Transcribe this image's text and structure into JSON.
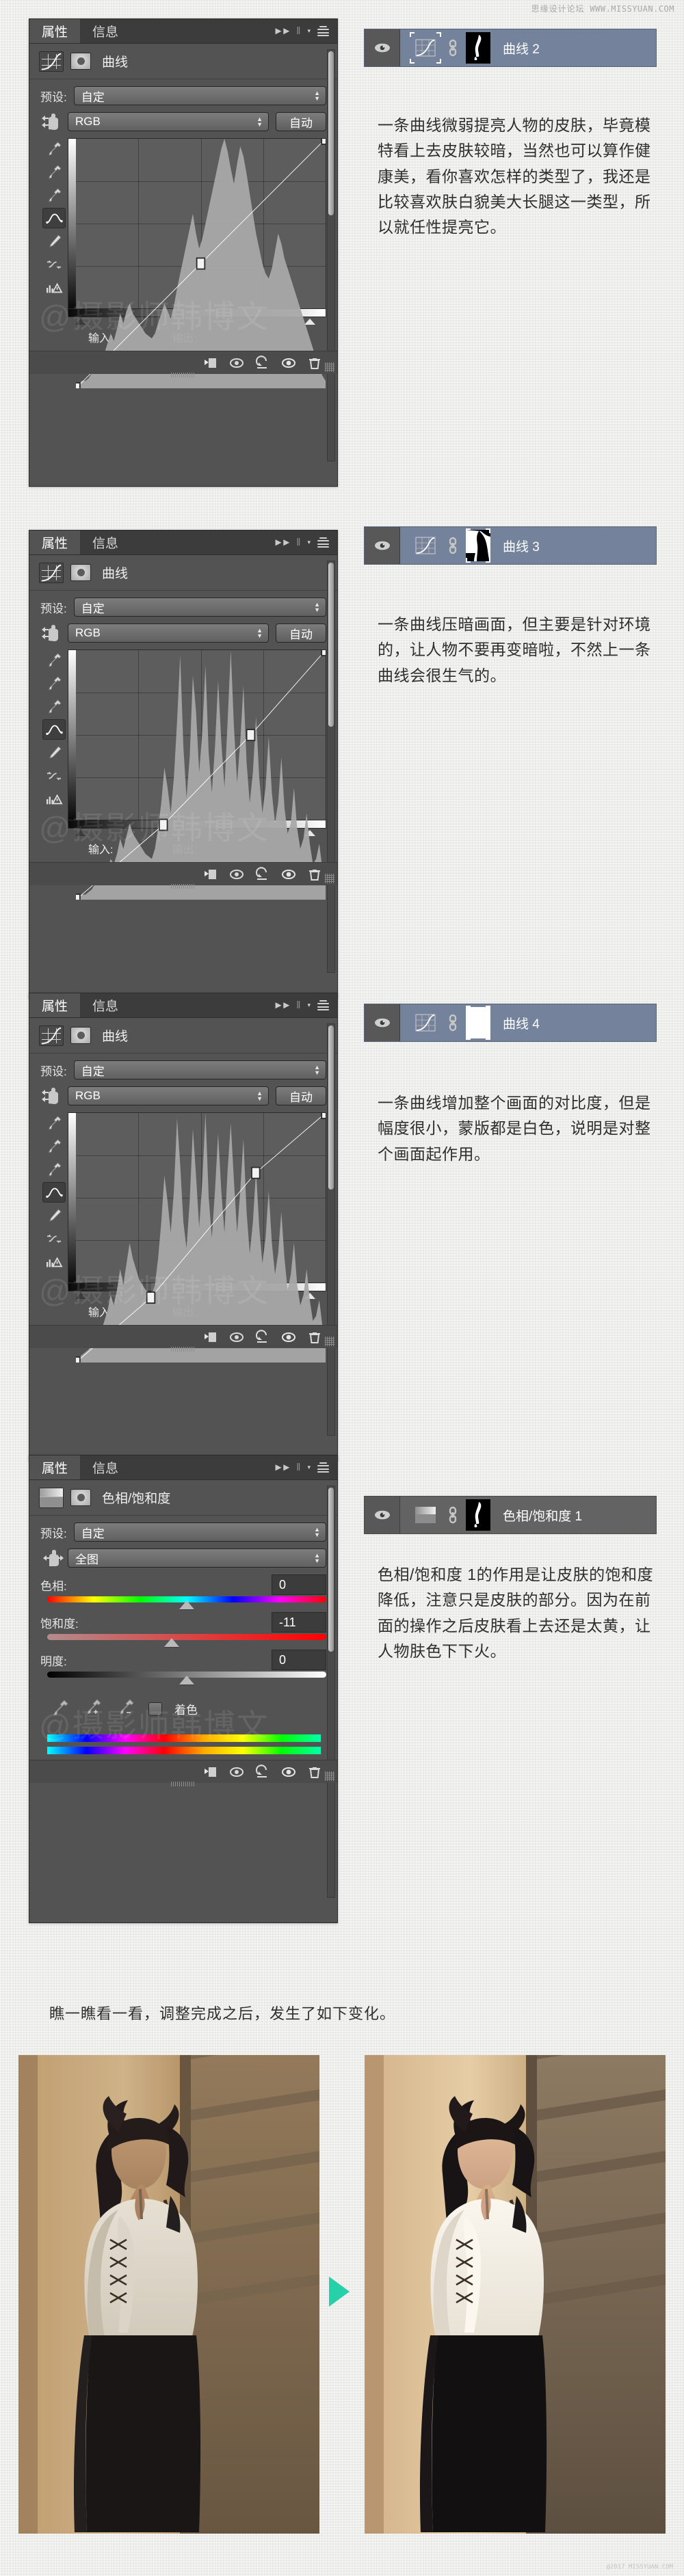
{
  "site": {
    "forum_cn": "思缘设计论坛",
    "url": "WWW.MISSYUAN.COM",
    "footer": "@2017 MISSYUAN.COM"
  },
  "panel_common": {
    "tab_properties": "属性",
    "tab_info": "信息",
    "preset_label": "预设:",
    "preset_value": "自定",
    "auto_button": "自动",
    "input_label": "输入:",
    "output_label": "输出:",
    "watermark": "@摄影师韩博文",
    "collapse_icon": "double-chevron-right-icon",
    "menu_icon": "panel-menu-icon"
  },
  "sections": [
    {
      "panel": {
        "title": "曲线",
        "channel": "RGB",
        "adjustment_icon": "curves-icon",
        "histogram": [
          2,
          2,
          3,
          3,
          4,
          6,
          9,
          13,
          11,
          14,
          18,
          22,
          19,
          24,
          30,
          26,
          31,
          34,
          30,
          28,
          26,
          24,
          22,
          21,
          20,
          22,
          26,
          30,
          34,
          31,
          28,
          33,
          40,
          46,
          52,
          58,
          64,
          70,
          62,
          56,
          60,
          66,
          72,
          78,
          84,
          90,
          96,
          100,
          95,
          88,
          82,
          90,
          97,
          93,
          86,
          78,
          70,
          62,
          56,
          50,
          46,
          44,
          48,
          55,
          62,
          58,
          52,
          48,
          44,
          40,
          36,
          32,
          28,
          24,
          20,
          16,
          12,
          8,
          5,
          3
        ],
        "curve_points": [
          [
            0,
            0
          ],
          [
            50,
            50
          ],
          [
            100,
            100
          ]
        ]
      },
      "layer": {
        "name": "曲线 2",
        "selected": true,
        "mask": "figure-silhouette-mask",
        "thumb": "curves-icon"
      },
      "text": "一条曲线微弱提亮人物的皮肤，毕竟模特看上去皮肤较暗，当然也可以算作健康美，看你喜欢怎样的类型了，我还是比较喜欢肤白貌美大长腿这一类型，所以就任性提亮它。"
    },
    {
      "panel": {
        "title": "曲线",
        "channel": "RGB",
        "adjustment_icon": "curves-icon",
        "histogram": [
          1,
          1,
          2,
          2,
          3,
          4,
          6,
          8,
          7,
          9,
          12,
          16,
          14,
          18,
          24,
          20,
          25,
          30,
          26,
          24,
          22,
          20,
          18,
          17,
          16,
          20,
          28,
          38,
          52,
          44,
          34,
          48,
          70,
          96,
          60,
          40,
          56,
          88,
          74,
          50,
          66,
          92,
          58,
          42,
          60,
          86,
          62,
          44,
          70,
          98,
          68,
          46,
          62,
          84,
          54,
          38,
          50,
          72,
          48,
          34,
          44,
          64,
          42,
          30,
          38,
          56,
          36,
          26,
          30,
          44,
          28,
          20,
          24,
          34,
          22,
          14,
          16,
          22,
          12,
          6
        ],
        "curve_points": [
          [
            0,
            0
          ],
          [
            35,
            30
          ],
          [
            70,
            66
          ],
          [
            100,
            100
          ]
        ]
      },
      "layer": {
        "name": "曲线 3",
        "selected": true,
        "mask": "figure-cutout-mask",
        "thumb": "curves-icon"
      },
      "text": "一条曲线压暗画面，但主要是针对环境的，让人物不要再变暗啦，不然上一条曲线会很生气的。"
    },
    {
      "panel": {
        "title": "曲线",
        "channel": "RGB",
        "adjustment_icon": "curves-icon",
        "histogram": [
          2,
          2,
          3,
          4,
          5,
          7,
          10,
          14,
          12,
          16,
          20,
          26,
          22,
          28,
          36,
          30,
          38,
          46,
          40,
          36,
          32,
          30,
          28,
          27,
          26,
          30,
          40,
          54,
          72,
          62,
          50,
          66,
          94,
          76,
          54,
          44,
          62,
          90,
          72,
          52,
          70,
          96,
          64,
          48,
          66,
          88,
          66,
          50,
          74,
          92,
          70,
          50,
          66,
          86,
          58,
          42,
          54,
          74,
          52,
          38,
          48,
          66,
          46,
          34,
          42,
          58,
          40,
          28,
          34,
          46,
          30,
          22,
          26,
          36,
          24,
          16,
          18,
          24,
          14,
          7
        ],
        "curve_points": [
          [
            0,
            0
          ],
          [
            30,
            26
          ],
          [
            72,
            76
          ],
          [
            100,
            100
          ]
        ]
      },
      "layer": {
        "name": "曲线 4",
        "selected": true,
        "mask": "white-mask",
        "thumb": "curves-icon"
      },
      "text": "一条曲线增加整个画面的对比度，但是幅度很小，蒙版都是白色，说明是对整个画面起作用。"
    },
    {
      "panel": {
        "title": "色相/饱和度",
        "adjustment_icon": "hue-saturation-icon",
        "range_value": "全图",
        "sliders": [
          {
            "label": "色相:",
            "value": "0",
            "track": "hue",
            "pos_pct": 50
          },
          {
            "label": "饱和度:",
            "value": "-11",
            "track": "sat",
            "pos_pct": 44.5
          },
          {
            "label": "明度:",
            "value": "0",
            "track": "lig",
            "pos_pct": 50
          }
        ],
        "colorize_label": "着色",
        "colorize_checked": false,
        "eyedroppers": [
          "eyedropper-icon",
          "eyedropper-add-icon",
          "eyedropper-subtract-icon"
        ]
      },
      "layer": {
        "name": "色相/饱和度 1",
        "selected": false,
        "mask": "figure-silhouette-mask",
        "thumb": "hue-saturation-icon"
      },
      "text": "色相/饱和度 1的作用是让皮肤的饱和度降低，注意只是皮肤的部分。因为在前面的操作之后皮肤看上去还是太黄，让人物肤色下下火。"
    }
  ],
  "closing_caption": "瞧一瞧看一看，调整完成之后，发生了如下变化。",
  "comparison": {
    "before_alt": "模特原图 — 调整前",
    "after_alt": "模特成图 — 调整后",
    "arrow_icon": "arrow-right-icon",
    "arrow_color": "#26d0a8"
  },
  "panel_footer_icons": [
    "clip-to-layer-icon",
    "view-previous-state-icon",
    "reset-icon",
    "toggle-visibility-icon",
    "delete-icon"
  ]
}
